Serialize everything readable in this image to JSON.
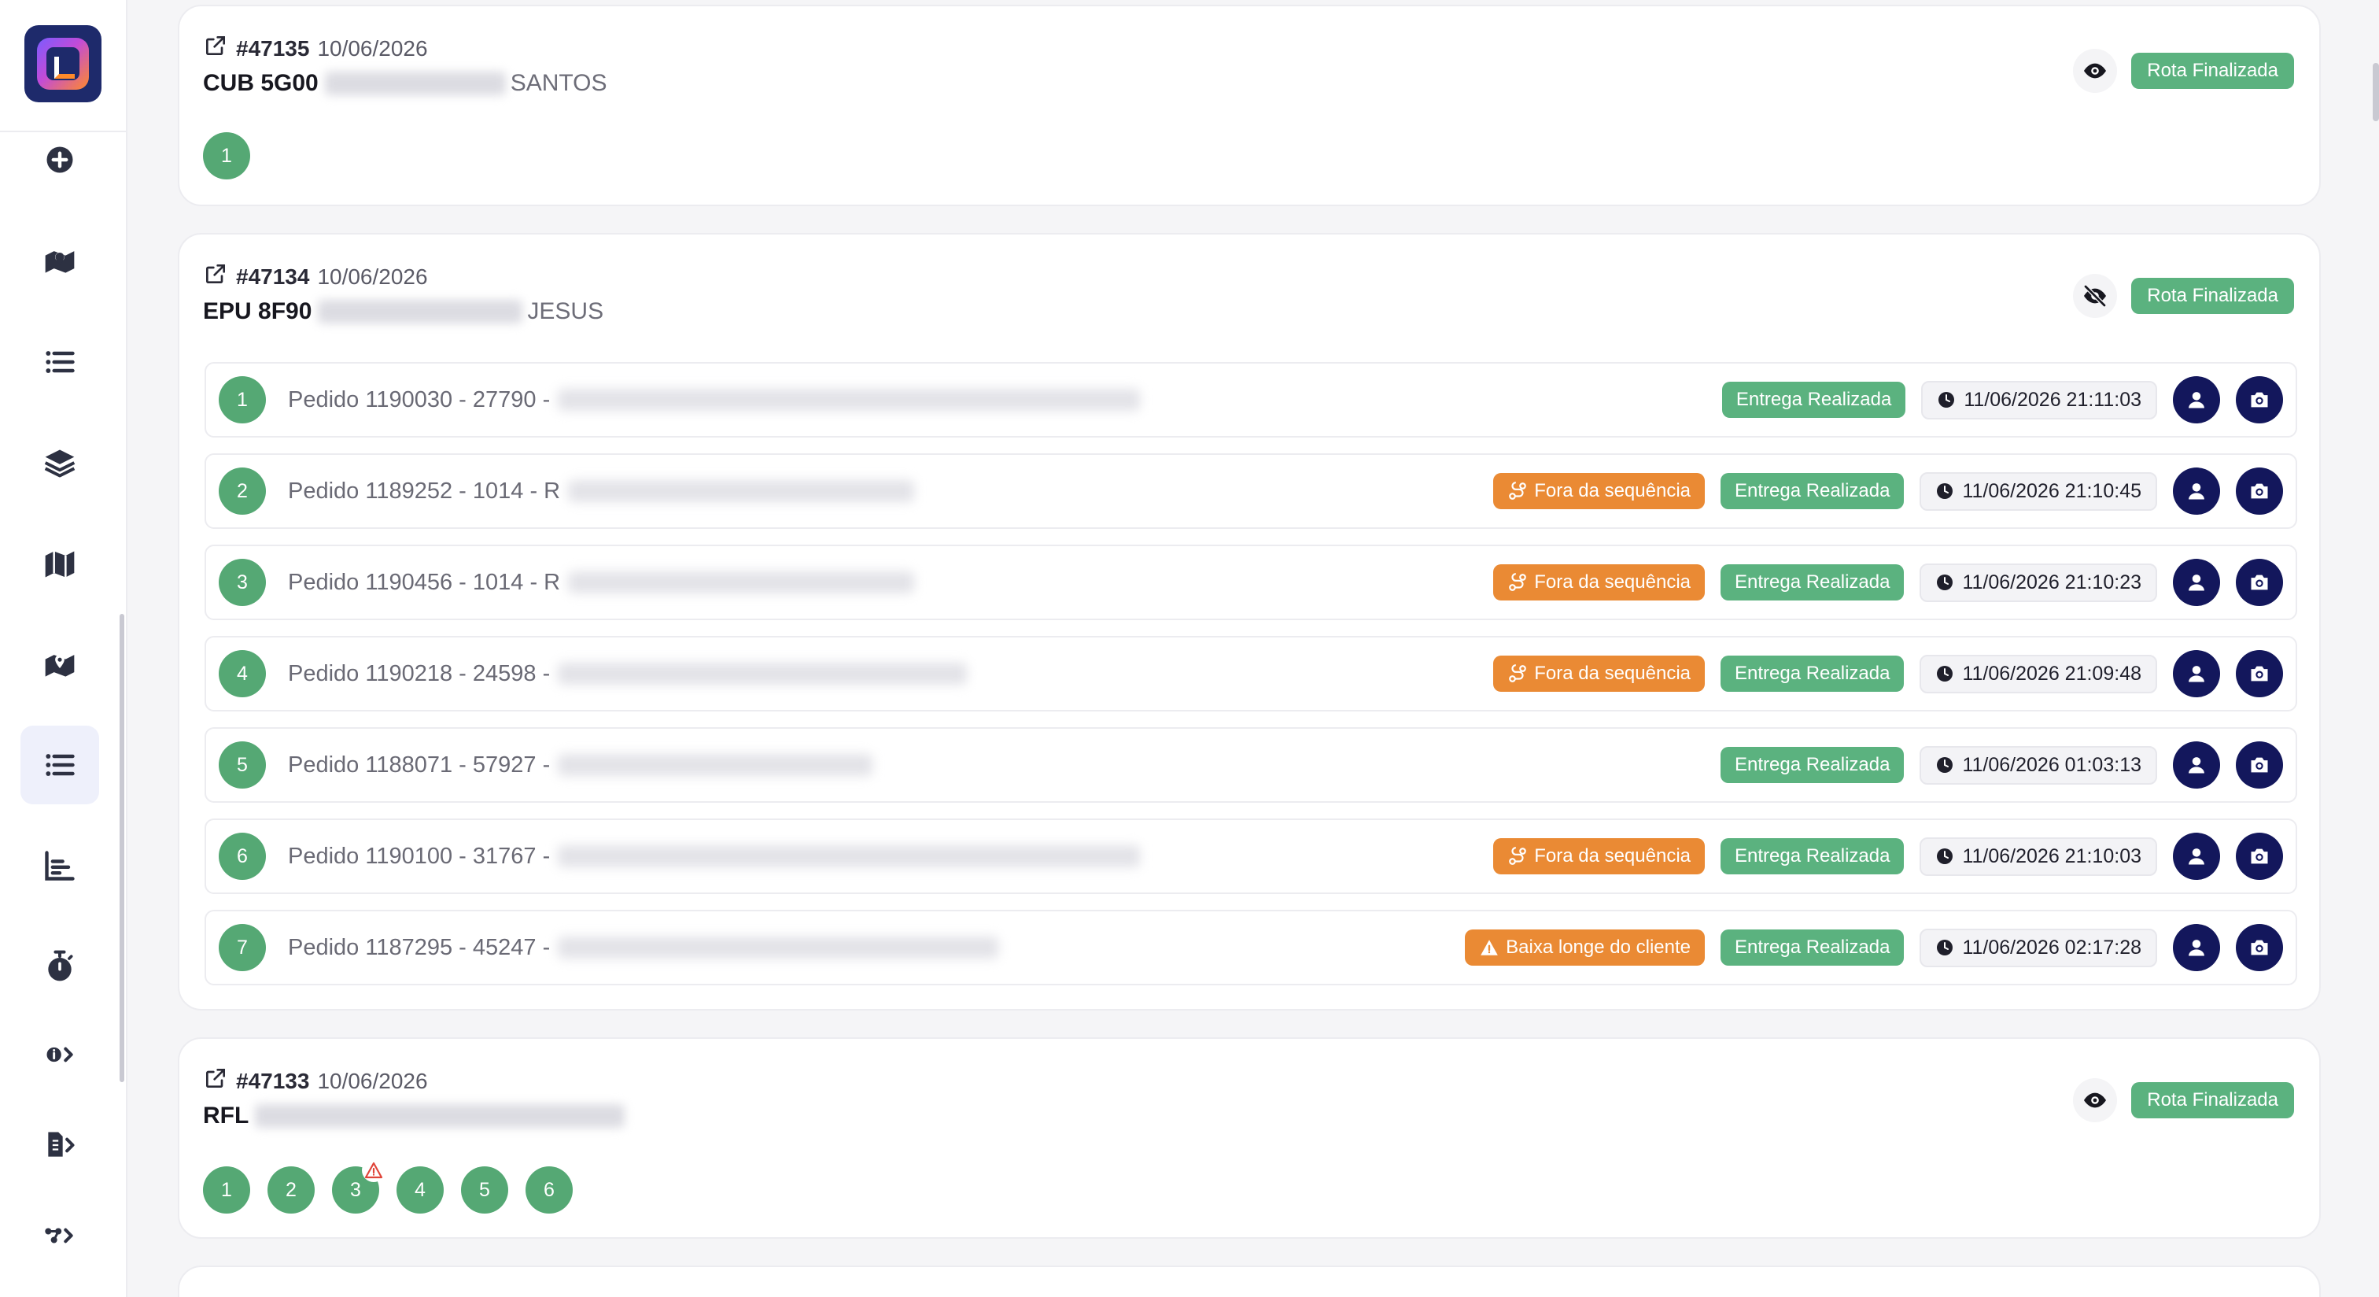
{
  "sidebar": {
    "logo": "app-logo",
    "items": [
      {
        "name": "add-circle-icon"
      },
      {
        "name": "map-pin-icon"
      },
      {
        "name": "list-icon"
      },
      {
        "name": "layers-icon"
      },
      {
        "name": "map-icon"
      },
      {
        "name": "map-pin-icon"
      },
      {
        "name": "list-icon",
        "active": true
      },
      {
        "name": "bar-chart-icon"
      },
      {
        "name": "stopwatch-icon"
      },
      {
        "name": "info-chevron-icon"
      },
      {
        "name": "invoice-chevron-icon"
      },
      {
        "name": "route-chevron-icon"
      }
    ]
  },
  "routes": [
    {
      "id": "#47135",
      "date": "10/06/2026",
      "plate": "CUB 5G00",
      "driver_tail": "SANTOS",
      "status": "Rota Finalizada",
      "visible": true,
      "dots": [
        "1"
      ]
    },
    {
      "id": "#47134",
      "date": "10/06/2026",
      "plate": "EPU 8F90",
      "driver_tail": "JESUS",
      "status": "Rota Finalizada",
      "visible": false,
      "stops": [
        {
          "num": "1",
          "pedido": "Pedido 1190030 - 27790 -",
          "flag": "",
          "delivery": "Entrega Realizada",
          "time": "11/06/2026 21:11:03"
        },
        {
          "num": "2",
          "pedido": "Pedido 1189252 - 1014 - R",
          "flag": "Fora da sequência",
          "delivery": "Entrega Realizada",
          "time": "11/06/2026 21:10:45"
        },
        {
          "num": "3",
          "pedido": "Pedido 1190456 - 1014 - R",
          "flag": "Fora da sequência",
          "delivery": "Entrega Realizada",
          "time": "11/06/2026 21:10:23"
        },
        {
          "num": "4",
          "pedido": "Pedido 1190218 - 24598 -",
          "flag": "Fora da sequência",
          "delivery": "Entrega Realizada",
          "time": "11/06/2026 21:09:48"
        },
        {
          "num": "5",
          "pedido": "Pedido 1188071 - 57927 -",
          "flag": "",
          "delivery": "Entrega Realizada",
          "time": "11/06/2026 01:03:13"
        },
        {
          "num": "6",
          "pedido": "Pedido 1190100 - 31767 -",
          "flag": "Fora da sequência",
          "delivery": "Entrega Realizada",
          "time": "11/06/2026 21:10:03"
        },
        {
          "num": "7",
          "pedido": "Pedido 1187295 - 45247 -",
          "flag": "Baixa longe do cliente",
          "delivery": "Entrega Realizada",
          "time": "11/06/2026 02:17:28"
        }
      ]
    },
    {
      "id": "#47133",
      "date": "10/06/2026",
      "plate": "RFL",
      "driver_tail": "",
      "status": "Rota Finalizada",
      "visible": true,
      "dots": [
        "1",
        "2",
        "3",
        "4",
        "5",
        "6"
      ],
      "warn_dot": "3"
    }
  ],
  "colors": {
    "accent": "#5bb27f",
    "orange": "#ea8a34",
    "navy": "#13175c"
  }
}
